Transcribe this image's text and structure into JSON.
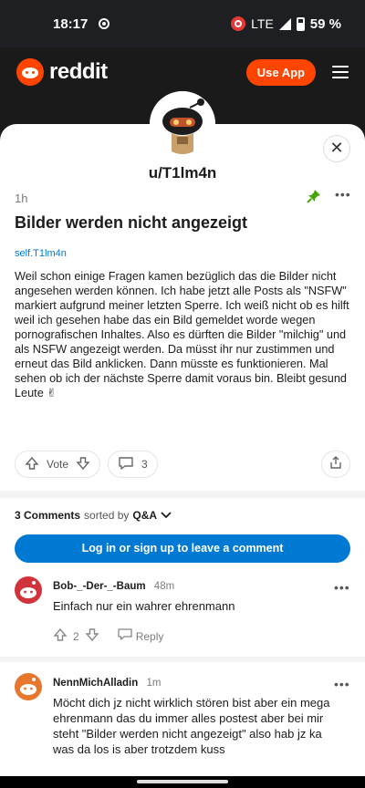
{
  "status_bar": {
    "time": "18:17",
    "network": "LTE",
    "battery": "59 %"
  },
  "header": {
    "brand": "reddit",
    "use_app": "Use App"
  },
  "post": {
    "username": "u/T1lm4n",
    "age": "1h",
    "title": "Bilder werden nicht angezeigt",
    "domain": "self.T1lm4n",
    "body": "Weil schon einige Fragen kamen bezüglich das die Bilder nicht angesehen werden können. Ich habe jetzt alle Posts als \"NSFW\" markiert aufgrund meiner letzten Sperre. Ich weiß nicht ob es hilft weil ich gesehen habe das ein Bild gemeldet worde wegen pornografischen Inhaltes. Also es dürften die Bilder \"milchig\" und als NSFW angezeigt werden. Da müsst ihr nur zustimmen und erneut das Bild anklicken. Dann müsste es funktionieren. Mal sehen ob ich der nächste Sperre damit voraus bin. Bleibt gesund Leute ✌",
    "vote_label": "Vote",
    "comment_count": "3"
  },
  "comments_section": {
    "count_label": "3 Comments",
    "sorted_by": "sorted by",
    "sort_value": "Q&A",
    "login_cta": "Log in or sign up to leave a comment",
    "comments": [
      {
        "author": "Bob-_-Der-_-Baum",
        "age": "48m",
        "text": "Einfach nur ein wahrer ehrenmann",
        "votes": "2",
        "reply": "Reply",
        "avatar_color": "#d0343a"
      },
      {
        "author": "NennMichAlladin",
        "age": "1m",
        "text": "Möcht dich jz nicht wirklich stören bist aber ein mega ehrenmann das du immer alles postest aber bei mir steht \"Bilder werden nicht angezeigt\" also hab jz ka was da los is aber trotzdem kuss",
        "avatar_color": "#e8772e"
      }
    ]
  },
  "colors": {
    "reddit_orange": "#ff4500",
    "link_blue": "#0079d3",
    "pin_green": "#46a508"
  }
}
